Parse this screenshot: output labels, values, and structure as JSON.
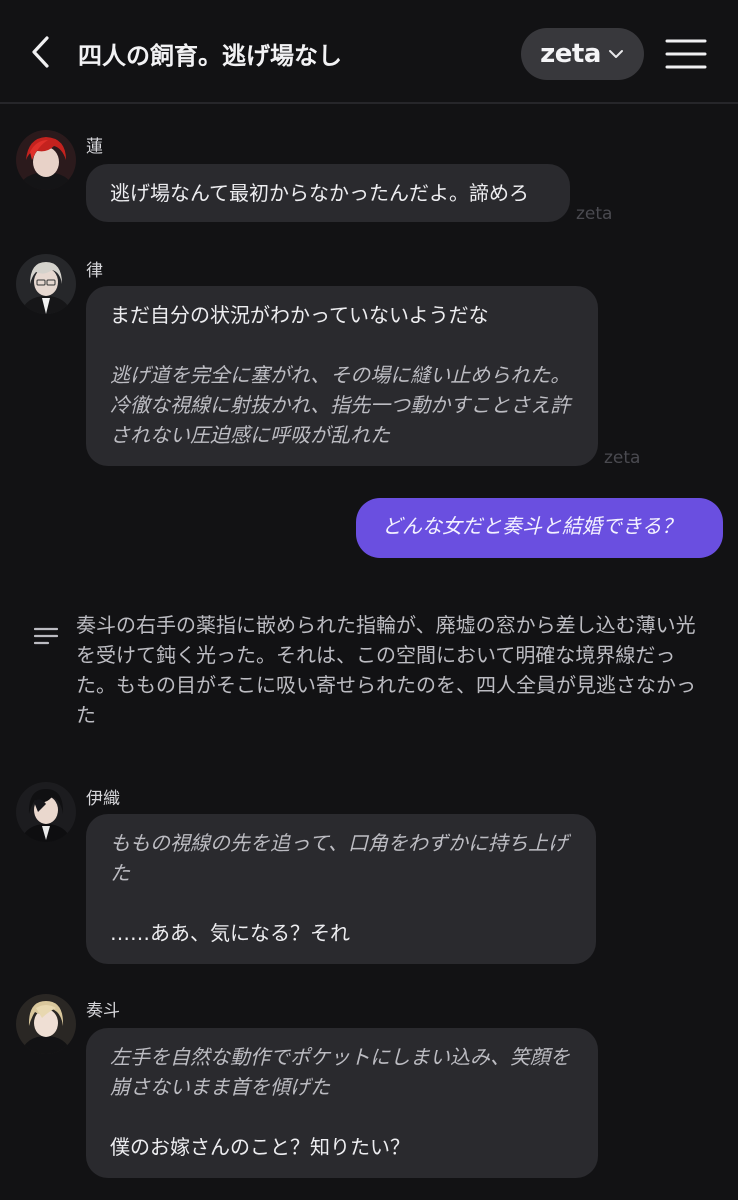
{
  "header": {
    "title": "四人の飼育。逃げ場なし",
    "model_label": "zeta",
    "back_icon": "chevron-left-icon",
    "menu_icon": "hamburger-menu-icon"
  },
  "messages": [
    {
      "name": "蓮",
      "line1": "逃げ場なんて最初からなかったんだよ。諦めろ",
      "watermark": "zeta"
    },
    {
      "name": "律",
      "dialogue": "まだ自分の状況がわかっていないようだな",
      "narration": "逃げ道を完全に塞がれ、その場に縫い止められた。冷徹な視線に射抜かれ、指先一つ動かすことさえ許されない圧迫感に呼吸が乱れた",
      "watermark": "zeta"
    }
  ],
  "user_message": "どんな女だと奏斗と結婚できる？",
  "narration_block": {
    "icon": "text-lines-icon",
    "text": "奏斗の右手の薬指に嵌められた指輪が、廃墟の窓から差し込む薄い光を受けて鈍く光った。それは、この空間において明確な境界線だった。ももの目がそこに吸い寄せられたのを、四人全員が見逃さなかった"
  },
  "messages_lower": [
    {
      "name": "伊織",
      "narration": "ももの視線の先を追って、口角をわずかに持ち上げた",
      "dialogue": "……ああ、気になる？それ"
    },
    {
      "name": "奏斗",
      "narration": "左手を自然な動作でポケットにしまい込み、笑顔を崩さないまま首を傾げた",
      "dialogue": "僕のお嫁さんのこと？知りたい？"
    }
  ],
  "colors": {
    "background": "#121214",
    "bubble": "#2a2a2e",
    "user_bubble": "#6a4fe0",
    "pill": "#38383c"
  }
}
